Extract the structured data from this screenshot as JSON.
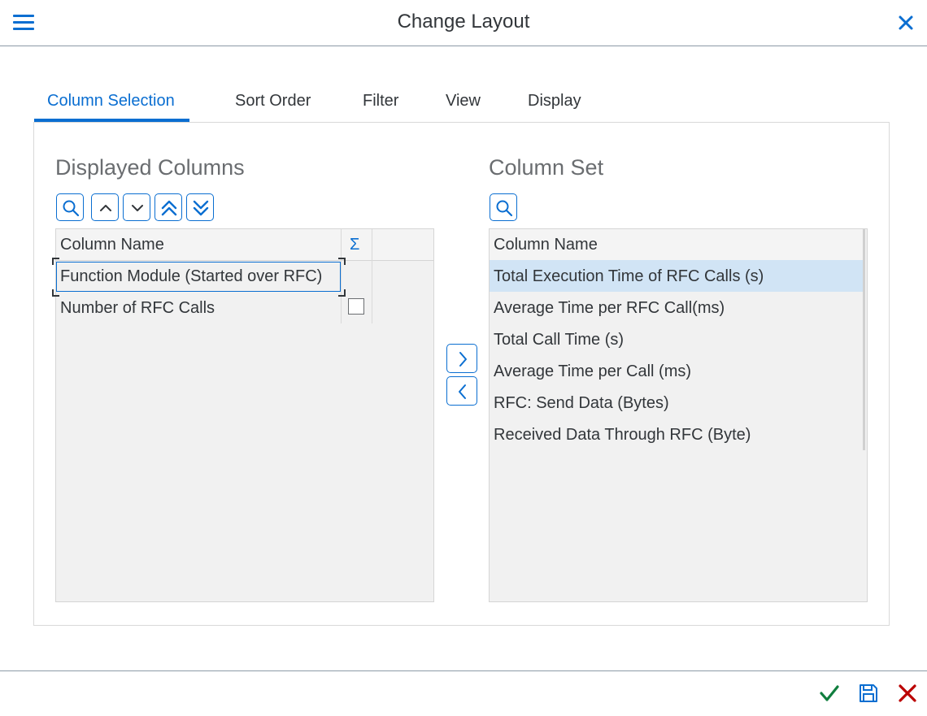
{
  "header": {
    "title": "Change Layout",
    "menu_icon": "hamburger-menu-icon",
    "close_icon": "close-icon"
  },
  "tabs": [
    {
      "label": "Column Selection",
      "active": true
    },
    {
      "label": "Sort Order"
    },
    {
      "label": "Filter"
    },
    {
      "label": "View"
    },
    {
      "label": "Display"
    }
  ],
  "displayed_columns": {
    "title": "Displayed Columns",
    "toolbar_icons": [
      "search-icon",
      "move-up-icon",
      "move-down-icon",
      "move-to-top-icon",
      "move-to-bottom-icon"
    ],
    "header": {
      "name": "Column Name",
      "sum": "Σ"
    },
    "rows": [
      {
        "name": "Function Module (Started over RFC)",
        "focused": true,
        "has_checkbox": false
      },
      {
        "name": "Number of RFC Calls",
        "has_checkbox": true,
        "checked": false
      }
    ]
  },
  "transfer": {
    "add_icon": "chevron-right-icon",
    "remove_icon": "chevron-left-icon"
  },
  "column_set": {
    "title": "Column Set",
    "toolbar_icons": [
      "search-icon"
    ],
    "header": {
      "name": "Column Name"
    },
    "rows": [
      {
        "name": "Total Execution Time of RFC Calls (s)",
        "selected": true
      },
      {
        "name": "Average Time per RFC Call(ms)"
      },
      {
        "name": "Total Call Time (s)"
      },
      {
        "name": "Average Time per Call (ms)"
      },
      {
        "name": "RFC: Send Data (Bytes)"
      },
      {
        "name": "Received Data Through RFC (Byte)"
      }
    ]
  },
  "footer": {
    "icons": [
      "checkmark-icon",
      "save-icon",
      "cancel-icon"
    ],
    "colors": {
      "confirm": "#107e3e",
      "save": "#0a6ed1",
      "cancel": "#bb0000"
    }
  },
  "colors": {
    "accent": "#0a6ed1",
    "selected_row": "#d1e4f5",
    "table_bg": "#f1f1f1"
  }
}
